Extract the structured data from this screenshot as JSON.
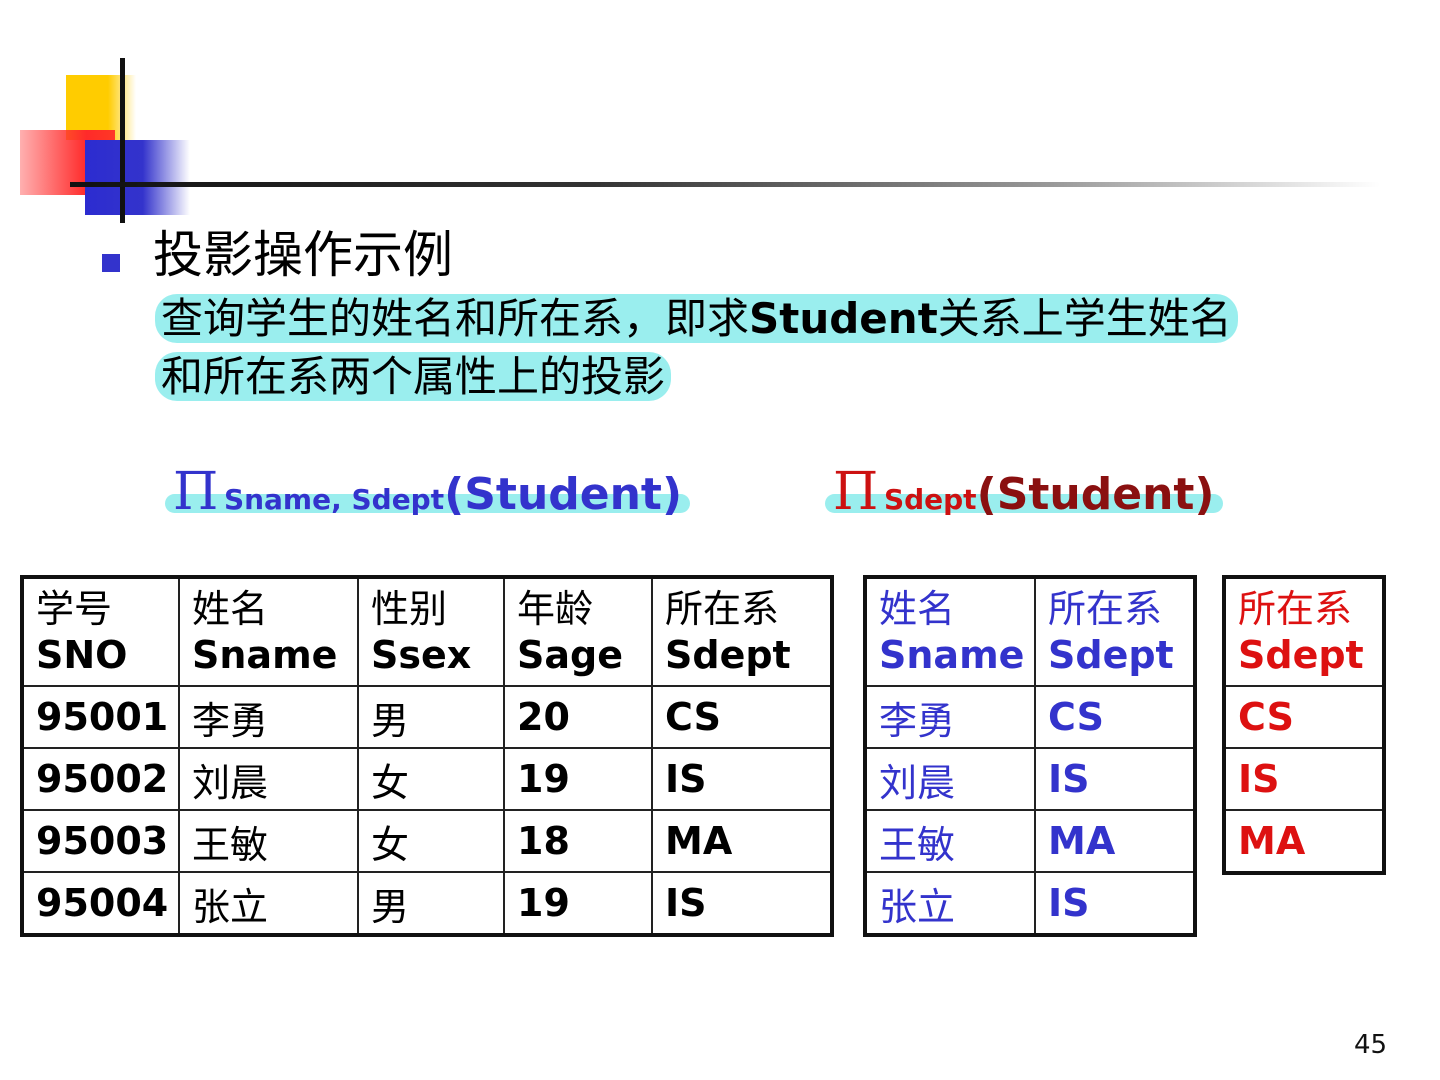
{
  "slide": {
    "heading": "投影操作示例",
    "para_line1_pre": "查询学生的姓名和所在系，即求",
    "para_line1_bold": "Student",
    "para_line1_post": "关系上学生姓名",
    "para_line2": "和所在系两个属性上的投影",
    "page_number": "45"
  },
  "formulas": {
    "f1": {
      "symbol": "Π",
      "subscript": "Sname, Sdept",
      "argument": "(Student)"
    },
    "f2": {
      "symbol": "Π",
      "subscript": "Sdept",
      "argument": "(Student)"
    }
  },
  "student_table": {
    "headers": [
      {
        "cn": "学号",
        "en": "SNO"
      },
      {
        "cn": "姓名",
        "en": "Sname"
      },
      {
        "cn": "性别",
        "en": "Ssex"
      },
      {
        "cn": "年龄",
        "en": "Sage"
      },
      {
        "cn": "所在系",
        "en": "Sdept"
      }
    ],
    "rows": [
      [
        "95001",
        "李勇",
        "男",
        "20",
        "CS"
      ],
      [
        "95002",
        "刘晨",
        "女",
        "19",
        "IS"
      ],
      [
        "95003",
        "王敏",
        "女",
        "18",
        "MA"
      ],
      [
        "95004",
        "张立",
        "男",
        "19",
        "IS"
      ]
    ]
  },
  "projection_table_1": {
    "headers": [
      {
        "cn": "姓名",
        "en": "Sname"
      },
      {
        "cn": "所在系",
        "en": "Sdept"
      }
    ],
    "rows": [
      [
        "李勇",
        "CS"
      ],
      [
        "刘晨",
        "IS"
      ],
      [
        "王敏",
        "MA"
      ],
      [
        "张立",
        "IS"
      ]
    ]
  },
  "projection_table_2": {
    "headers": [
      {
        "cn": "所在系",
        "en": "Sdept"
      }
    ],
    "rows": [
      [
        "CS"
      ],
      [
        "IS"
      ],
      [
        "MA"
      ]
    ]
  },
  "colors": {
    "accent_blue": "#3333cc",
    "accent_red": "#dd1111",
    "highlight_cyan": "#78e8e8"
  }
}
